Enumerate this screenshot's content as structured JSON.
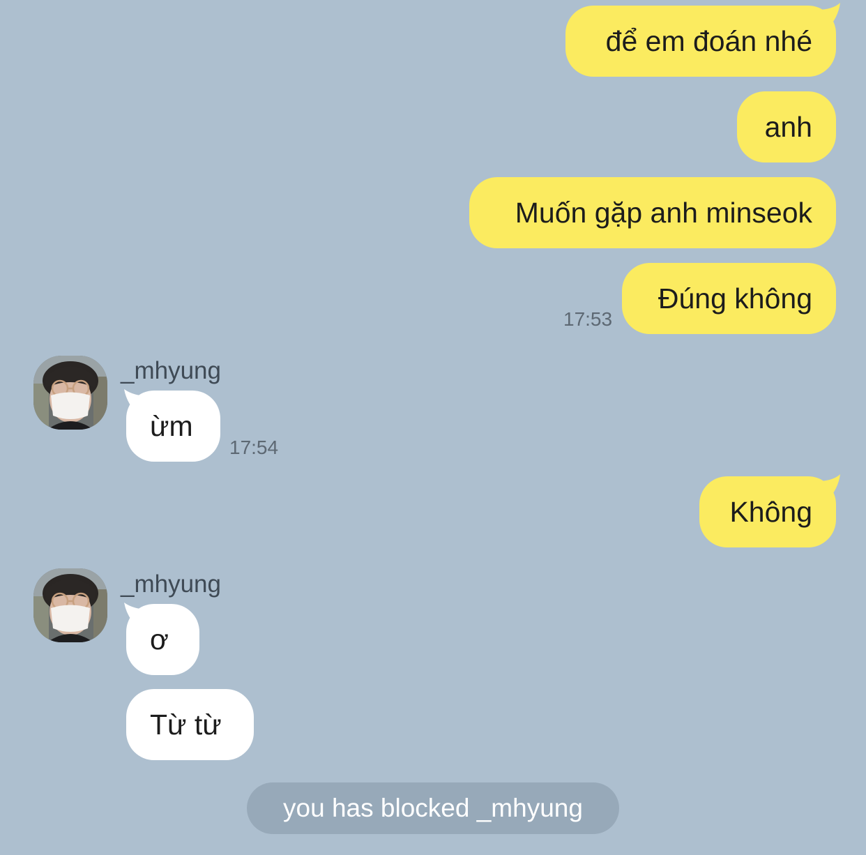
{
  "chat": {
    "sent": [
      {
        "text": "để em đoán nhé"
      },
      {
        "text": "anh"
      },
      {
        "text": "Muốn gặp anh minseok"
      },
      {
        "text": "Đúng không",
        "time": "17:53"
      },
      {
        "text": "Không"
      }
    ],
    "groups": [
      {
        "sender": "_mhyung",
        "messages": [
          {
            "text": "ừm",
            "time": "17:54"
          }
        ]
      },
      {
        "sender": "_mhyung",
        "messages": [
          {
            "text": "ơ"
          },
          {
            "text": "Từ từ"
          }
        ]
      }
    ],
    "system_notice": "you has blocked _mhyung"
  },
  "colors": {
    "background": "#adbfcf",
    "sent_bubble": "#fbeb60",
    "received_bubble": "#ffffff",
    "notice_pill": "#97a9b9"
  },
  "icons": {
    "avatar": "profile-photo-avatar"
  }
}
